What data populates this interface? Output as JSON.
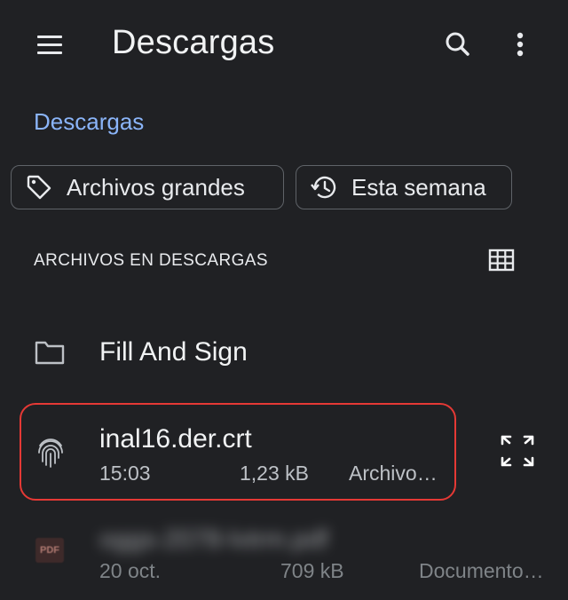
{
  "appbar": {
    "title": "Descargas",
    "menu_icon": "hamburger-menu-icon",
    "search_icon": "search-icon",
    "more_icon": "more-vert-icon"
  },
  "breadcrumb": "Descargas",
  "chips": [
    {
      "label": "Archivos grandes",
      "icon": "tag-icon"
    },
    {
      "label": "Esta semana",
      "icon": "history-icon"
    }
  ],
  "section": {
    "header": "ARCHIVOS EN DESCARGAS",
    "grid_icon": "grid-view-icon"
  },
  "items": [
    {
      "name": "Fill And Sign",
      "kind": "folder",
      "icon": "folder-icon"
    },
    {
      "name": "inal16.der.crt",
      "time": "15:03",
      "size": "1,23 kB",
      "type": "Archivo…",
      "icon": "fingerprint-icon",
      "highlighted": true,
      "action_icon": "expand-icon"
    },
    {
      "name": "oggs-2078-lvtrm.pdf",
      "time": "20 oct.",
      "size": "709 kB",
      "type": "Documento…",
      "icon": "pdf-icon",
      "icon_text": "PDF",
      "blurred": true
    }
  ],
  "colors": {
    "background": "#202124",
    "accent": "#8ab4f8",
    "highlight_border": "#e53935"
  }
}
